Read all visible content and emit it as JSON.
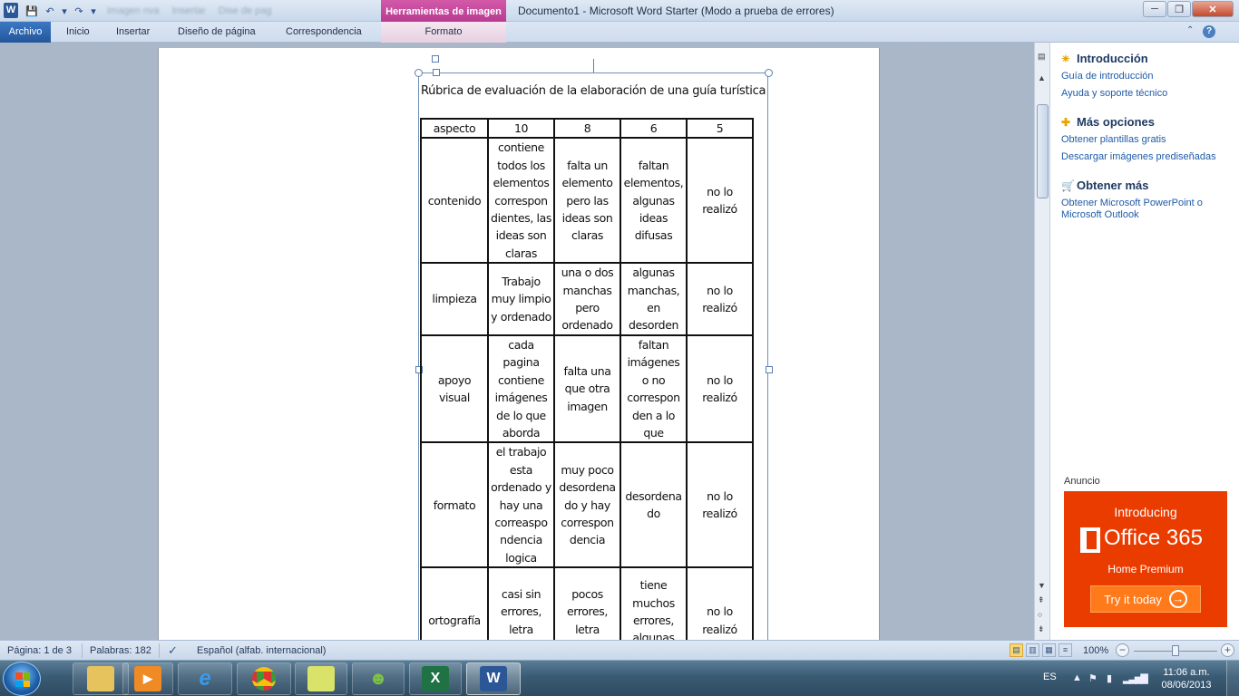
{
  "window": {
    "app_letter": "W",
    "title": "Documento1  -  Microsoft Word Starter (Modo a prueba de errores)",
    "contextual_group": "Herramientas de imagen",
    "blurred_tabs": [
      "Imagen nva",
      "Insertar",
      "Dise de pag"
    ],
    "controls": {
      "minimize": "─",
      "restore": "❐",
      "close": "✕"
    }
  },
  "qat": {
    "save_icon": "💾",
    "undo_icon": "↶",
    "redo_icon": "↷",
    "more_icon": "▾"
  },
  "ribbon": {
    "tabs": [
      {
        "label": "Archivo"
      },
      {
        "label": "Inicio"
      },
      {
        "label": "Insertar"
      },
      {
        "label": "Diseño de página"
      },
      {
        "label": "Correspondencia"
      },
      {
        "label": "Formato"
      }
    ],
    "help": "?",
    "caret": "⌃"
  },
  "document": {
    "rubric_title": "Rúbrica de evaluación de la elaboración de una guía turística",
    "table": {
      "headers": [
        "aspecto",
        "10",
        "8",
        "6",
        "5"
      ],
      "rows": [
        [
          "contenido",
          "contiene todos los elementos correspon dientes, las ideas son claras",
          "falta un elemento pero las ideas son claras",
          "faltan elementos, algunas ideas difusas",
          "no lo realizó"
        ],
        [
          "limpieza",
          "Trabajo muy limpio y ordenado",
          "una o dos manchas pero ordenado",
          "algunas manchas, en desorden",
          "no lo realizó"
        ],
        [
          "apoyo visual",
          "cada pagina contiene imágenes de lo que aborda",
          "falta una que otra imagen",
          "faltan imágenes o no correspon den a lo que",
          "no lo realizó"
        ],
        [
          "formato",
          "el trabajo esta ordenado y hay una correaspo ndencia logica",
          "muy poco desordena do y hay correspon dencia",
          "desordena do",
          "no lo realizó"
        ],
        [
          "ortografía",
          "casi sin errores, letra legible",
          "pocos errores, letra legible",
          "tiene muchos errores, algunas palabras",
          "no lo realizó"
        ]
      ]
    }
  },
  "pane": {
    "sections": [
      {
        "heading": "Introducción",
        "icon": "star-icon",
        "glyph": "✴",
        "links": [
          "Guía de introducción",
          "Ayuda y soporte técnico"
        ]
      },
      {
        "heading": "Más opciones",
        "icon": "plus-icon",
        "glyph": "✚",
        "links": [
          "Obtener plantillas gratis",
          "Descargar imágenes prediseñadas"
        ]
      },
      {
        "heading": "Obtener más",
        "icon": "cart-icon",
        "glyph": "🛒",
        "links": [
          "Obtener Microsoft PowerPoint o Microsoft Outlook"
        ]
      }
    ],
    "ad_label": "Anuncio",
    "ad": {
      "intro": "Introducing",
      "product": "Office 365",
      "edition": "Home Premium",
      "cta": "Try it today",
      "color": "#eb3c00"
    }
  },
  "status": {
    "page": "Página: 1 de 3",
    "words": "Palabras: 182",
    "language": "Español (alfab. internacional)",
    "zoom": "100%",
    "zoom_level": 1.0
  },
  "taskbar": {
    "apps": [
      "explorer",
      "media-player",
      "internet-explorer",
      "chrome",
      "folder",
      "messenger",
      "excel",
      "word"
    ],
    "tray": {
      "lang": "ES",
      "time": "11:06 a.m.",
      "date": "08/06/2013"
    }
  }
}
